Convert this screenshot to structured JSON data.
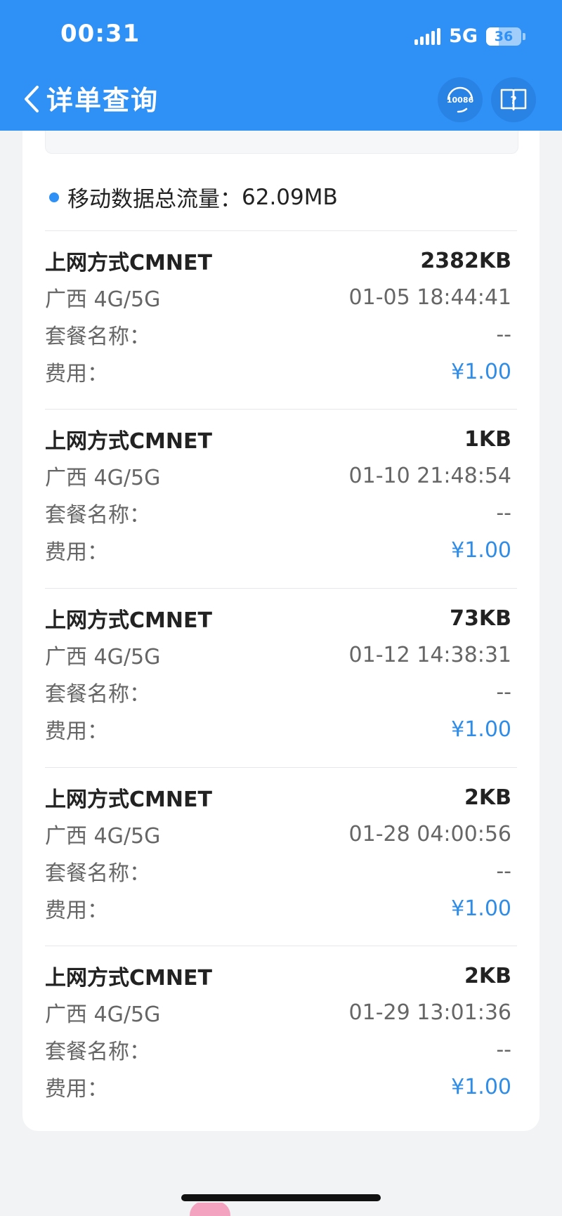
{
  "status_bar": {
    "time": "00:31",
    "network": "5G",
    "battery_level": "36",
    "battery_fraction": 0.36
  },
  "header": {
    "title": "详单查询",
    "hotline_label": "10086",
    "icons": [
      "chevron-left-icon",
      "headset-10086-icon",
      "help-book-icon"
    ]
  },
  "summary": {
    "label": "移动数据总流量：",
    "value": "62.09MB"
  },
  "records": [
    {
      "method": "上网方式CMNET",
      "usage": "2382KB",
      "region": "广西 4G/5G",
      "time": "01-05 18:44:41",
      "package_label": "套餐名称：",
      "package_value": "--",
      "fee_label": "费用：",
      "fee_value": "¥1.00"
    },
    {
      "method": "上网方式CMNET",
      "usage": "1KB",
      "region": "广西 4G/5G",
      "time": "01-10 21:48:54",
      "package_label": "套餐名称：",
      "package_value": "--",
      "fee_label": "费用：",
      "fee_value": "¥1.00"
    },
    {
      "method": "上网方式CMNET",
      "usage": "73KB",
      "region": "广西 4G/5G",
      "time": "01-12 14:38:31",
      "package_label": "套餐名称：",
      "package_value": "--",
      "fee_label": "费用：",
      "fee_value": "¥1.00"
    },
    {
      "method": "上网方式CMNET",
      "usage": "2KB",
      "region": "广西 4G/5G",
      "time": "01-28 04:00:56",
      "package_label": "套餐名称：",
      "package_value": "--",
      "fee_label": "费用：",
      "fee_value": "¥1.00"
    },
    {
      "method": "上网方式CMNET",
      "usage": "2KB",
      "region": "广西 4G/5G",
      "time": "01-29 13:01:36",
      "package_label": "套餐名称：",
      "package_value": "--",
      "fee_label": "费用：",
      "fee_value": "¥1.00"
    }
  ],
  "colors": {
    "header_bg": "#2f90f5",
    "accent": "#2f8de8",
    "page_bg": "#f2f3f5"
  }
}
